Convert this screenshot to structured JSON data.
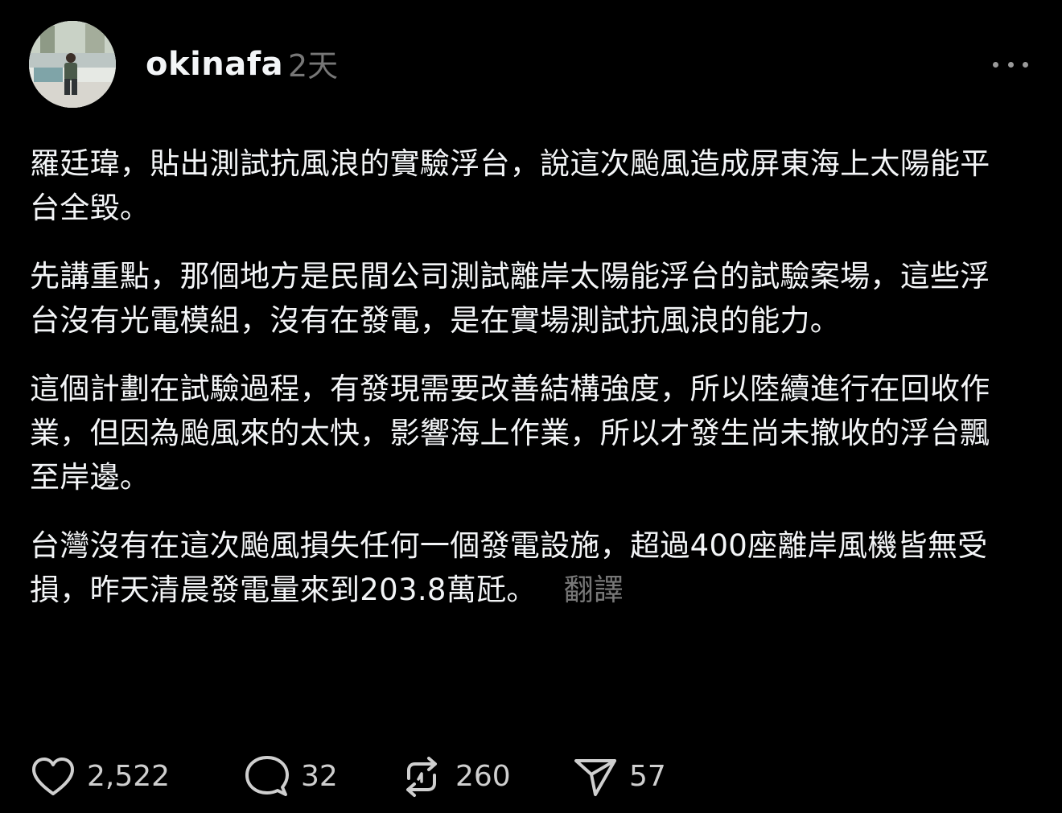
{
  "post": {
    "username": "okinafa",
    "timestamp": "2天",
    "paragraphs": [
      "羅廷瑋，貼出測試抗風浪的實驗浮台，說這次颱風造成屏東海上太陽能平台全毀。",
      "先講重點，那個地方是民間公司測試離岸太陽能浮台的試驗案場，這些浮台沒有光電模組，沒有在發電，是在實場測試抗風浪的能力。",
      "這個計劃在試驗過程，有發現需要改善結構強度，所以陸續進行在回收作業，但因為颱風來的太快，影響海上作業，所以才發生尚未撤收的浮台飄至岸邊。",
      "台灣沒有在這次颱風損失任何一個發電設施，超過400座離岸風機皆無受損，昨天清晨發電量來到203.8萬瓩。"
    ],
    "translate_label": "翻譯"
  },
  "actions": {
    "likes": "2,522",
    "comments": "32",
    "reposts": "260",
    "shares": "57"
  },
  "icons": {
    "more": "more-horizontal-icon",
    "like": "heart-icon",
    "comment": "speech-bubble-icon",
    "repost": "repost-arrows-icon",
    "share": "paper-plane-icon"
  },
  "colors": {
    "background": "#000000",
    "text": "#f3f5f7",
    "muted": "#777777",
    "icon": "#cfcfcf"
  }
}
